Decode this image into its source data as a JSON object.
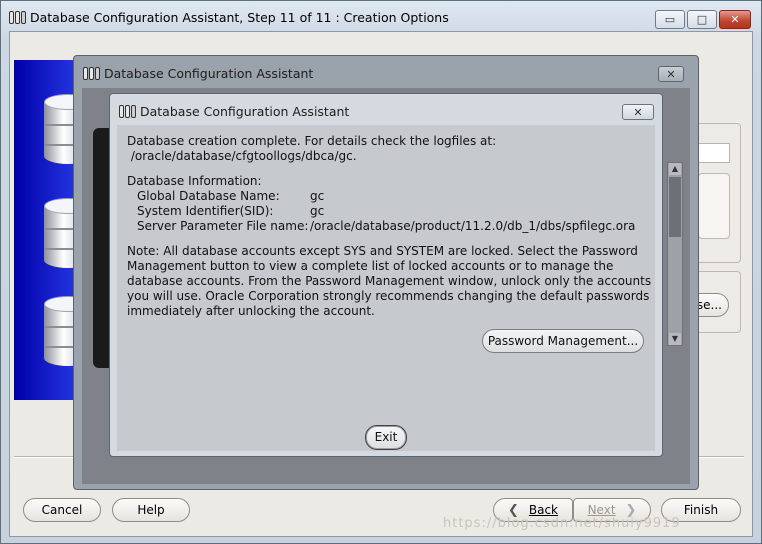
{
  "window": {
    "title": "Database Configuration Assistant, Step 11 of 11 : Creation Options",
    "minimize_glyph": "▭",
    "maximize_glyph": "□",
    "close_glyph": "✕"
  },
  "background": {
    "right_button_label": "se..."
  },
  "footer": {
    "cancel_label": "Cancel",
    "help_label": "Help",
    "back_label": "Back",
    "next_label": "Next",
    "finish_label": "Finish",
    "back_arrow": "❮",
    "next_arrow": "❯",
    "watermark": "https://blog.csdn.net/shuiy9919"
  },
  "middle_dialog": {
    "title": "Database Configuration Assistant",
    "close_glyph": "✕"
  },
  "dialog": {
    "title": "Database Configuration Assistant",
    "close_glyph": "✕",
    "message_line1": "Database creation complete. For details check the logfiles at:",
    "message_line2": " /oracle/database/cfgtoollogs/dbca/gc.",
    "info_header": "Database Information:",
    "info": [
      {
        "label": "Global Database Name:",
        "value": "gc"
      },
      {
        "label": "System Identifier(SID):",
        "value": "gc"
      },
      {
        "label": "Server Parameter File name:",
        "value": "/oracle/database/product/11.2.0/db_1/dbs/spfilegc.ora"
      }
    ],
    "note_lines": [
      "Note: All database accounts except SYS and SYSTEM are locked. Select the Password",
      "Management button to view a complete list of locked accounts or to manage the",
      "database accounts. From the Password Management window, unlock only the accounts",
      "you will use. Oracle Corporation strongly recommends changing the default passwords",
      "immediately after unlocking the account."
    ],
    "password_button": "Password Management...",
    "exit_button": "Exit"
  },
  "colors": {
    "banner_blue": "#0000a8",
    "close_red": "#c0432c",
    "overlay_gray": "#9aa3ab"
  }
}
